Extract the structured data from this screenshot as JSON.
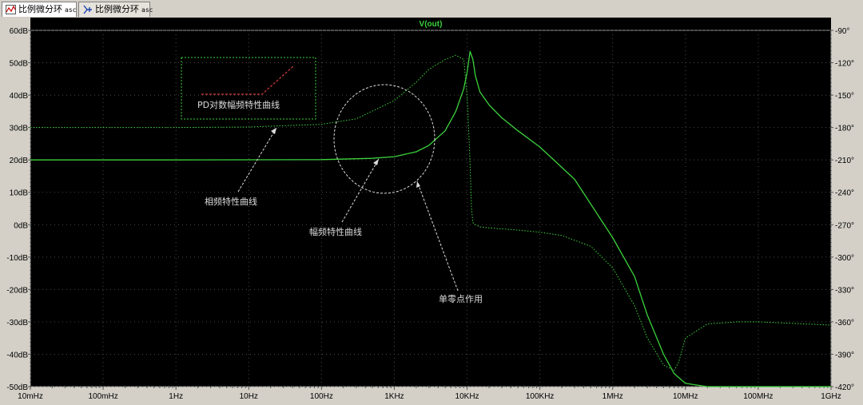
{
  "tabs": [
    {
      "label": "比例微分环",
      "ext": "asc",
      "icon": "waveform-icon"
    },
    {
      "label": "比例微分环",
      "ext": "asc",
      "icon": "schematic-icon"
    }
  ],
  "chart_data": {
    "type": "line",
    "title": "V(out)",
    "x_scale": "log",
    "x_range_hz": [
      0.01,
      1000000000
    ],
    "x_ticks": [
      "10mHz",
      "100mHz",
      "1Hz",
      "10Hz",
      "100Hz",
      "1KHz",
      "10KHz",
      "100KHz",
      "1MHz",
      "10MHz",
      "100MHz",
      "1GHz"
    ],
    "y_left_range_db": [
      -50,
      60
    ],
    "y_left_ticks": [
      "60dB",
      "50dB",
      "40dB",
      "30dB",
      "20dB",
      "10dB",
      "0dB",
      "-10dB",
      "-20dB",
      "-30dB",
      "-40dB",
      "-50dB"
    ],
    "y_right_range_deg": [
      -420,
      -90
    ],
    "y_right_ticks": [
      "-90°",
      "-120°",
      "-150°",
      "-180°",
      "-210°",
      "-240°",
      "-270°",
      "-300°",
      "-330°",
      "-360°",
      "-390°",
      "-420°"
    ],
    "colors": {
      "magnitude": "#3cd23c",
      "phase": "#3cd23c",
      "title": "#3cd23c",
      "annotation": "#dcdcdc",
      "legend_box": "#3cd23c",
      "legend_trace": "#d23c3c",
      "axis_text": "#000000"
    },
    "series": [
      {
        "name": "",
        "style": "solid",
        "axis": "left",
        "unit": "dB",
        "x": [
          0.01,
          1,
          100,
          500,
          1000,
          2000,
          3000,
          5000,
          7000,
          9000,
          10000,
          11000,
          12000,
          13000,
          15000,
          20000,
          30000,
          50000,
          100000,
          300000,
          1000000,
          2000000,
          3000000,
          5000000,
          7000000,
          10000000,
          20000000,
          100000000,
          1000000000
        ],
        "y": [
          20,
          20,
          20.1,
          20.5,
          21,
          22.5,
          24.5,
          29,
          35,
          42,
          47,
          53.5,
          51,
          46,
          41,
          37,
          33,
          29,
          24,
          14,
          -4,
          -16,
          -28,
          -40,
          -46,
          -49,
          -50,
          -50,
          -50
        ]
      },
      {
        "name": "",
        "style": "dotted",
        "axis": "right",
        "unit": "deg",
        "x": [
          0.01,
          1,
          10,
          100,
          300,
          1000,
          2000,
          3000,
          5000,
          7000,
          9000,
          10000,
          10800,
          11500,
          12000,
          13000,
          15000,
          20000,
          50000,
          100000,
          200000,
          500000,
          1000000,
          2000000,
          3000000,
          5000000,
          7000000,
          8000000,
          10000000,
          20000000,
          50000000,
          100000000,
          1000000000
        ],
        "y": [
          -180,
          -180,
          -179.5,
          -177,
          -172,
          -155,
          -138,
          -126,
          -117,
          -113,
          -117,
          -150,
          -200,
          -255,
          -268,
          -270,
          -272,
          -273,
          -275,
          -277,
          -280,
          -290,
          -310,
          -345,
          -375,
          -400,
          -405,
          -398,
          -375,
          -362,
          -360,
          -360,
          -363
        ]
      }
    ],
    "annotations": [
      {
        "id": "pd",
        "text": "PD对数幅频特性曲线"
      },
      {
        "id": "phase",
        "text": "相频特性曲线"
      },
      {
        "id": "mag",
        "text": "幅频特性曲线"
      },
      {
        "id": "zero",
        "text": "单零点作用"
      }
    ]
  }
}
